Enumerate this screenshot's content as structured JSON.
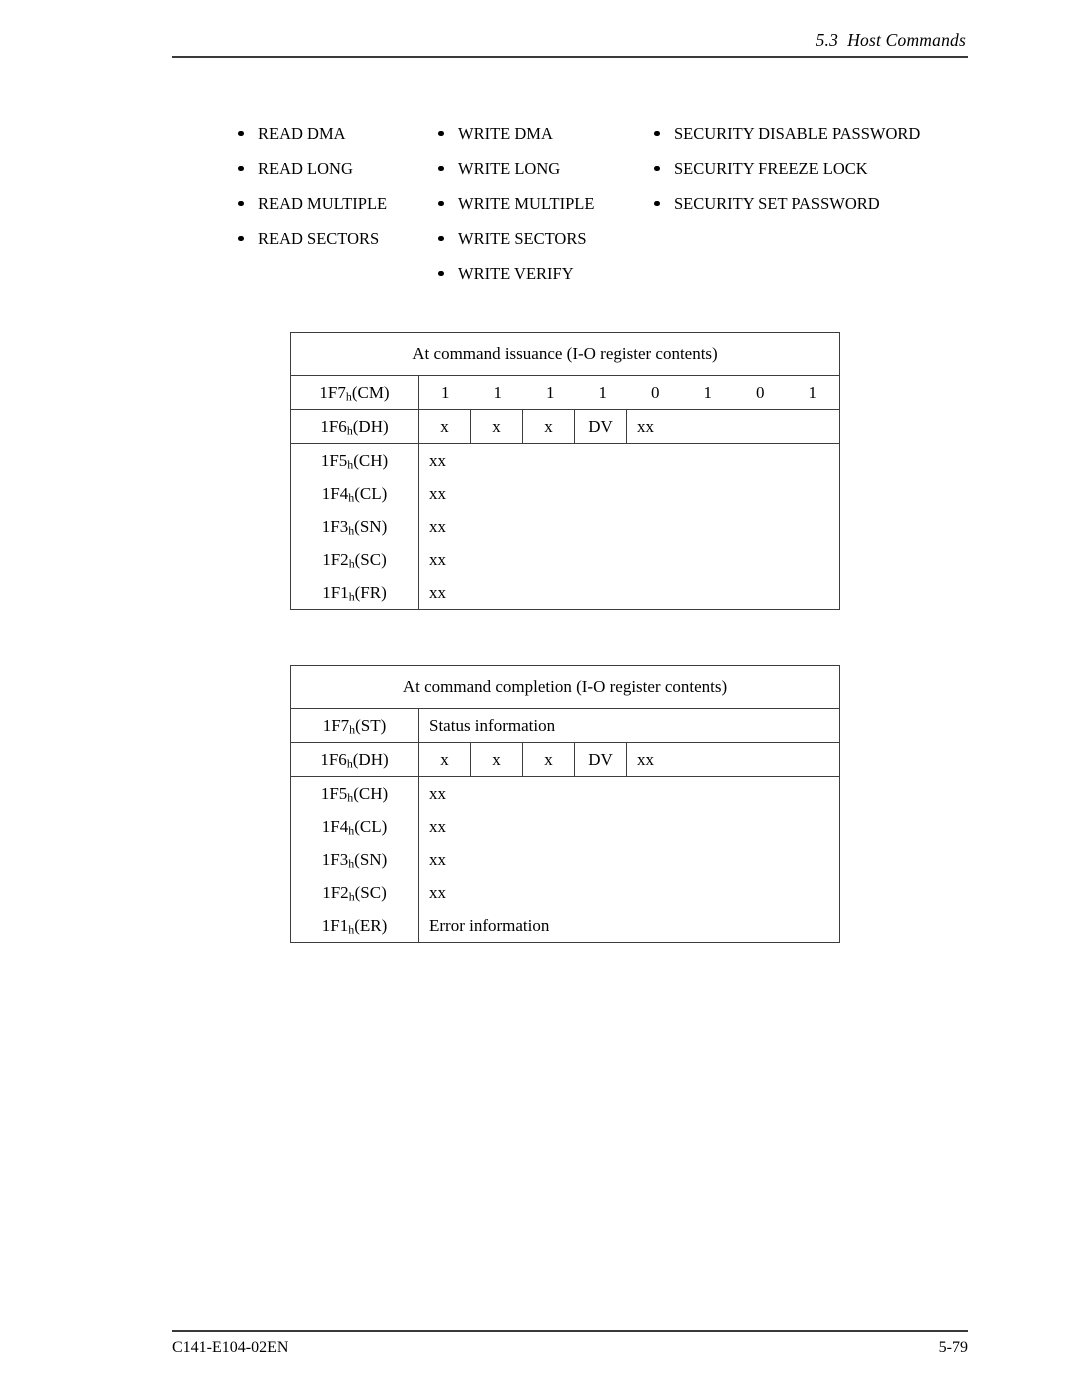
{
  "header": {
    "section": "5.3  Host Commands"
  },
  "command_columns": [
    {
      "name": "read-commands",
      "items": [
        "READ DMA",
        "READ LONG",
        "READ MULTIPLE",
        "READ SECTORS"
      ]
    },
    {
      "name": "write-commands",
      "items": [
        "WRITE DMA",
        "WRITE LONG",
        "WRITE MULTIPLE",
        "WRITE SECTORS",
        "WRITE VERIFY"
      ]
    },
    {
      "name": "security-commands",
      "items": [
        "SECURITY DISABLE PASSWORD",
        "SECURITY FREEZE LOCK",
        "SECURITY SET PASSWORD"
      ]
    }
  ],
  "tables": {
    "issuance": {
      "caption": "At command issuance (I-O register contents)",
      "command_row": {
        "address": "1F7",
        "subscript": "h",
        "register": "(CM)",
        "bits": [
          "1",
          "1",
          "1",
          "1",
          "0",
          "1",
          "0",
          "1"
        ]
      },
      "device_head_row": {
        "address": "1F6",
        "subscript": "h",
        "register": "(DH)",
        "cells": [
          "x",
          "x",
          "x",
          "DV"
        ],
        "rest": "xx"
      },
      "rows": [
        {
          "address": "1F5",
          "subscript": "h",
          "register": "(CH)",
          "value": "xx"
        },
        {
          "address": "1F4",
          "subscript": "h",
          "register": "(CL)",
          "value": "xx"
        },
        {
          "address": "1F3",
          "subscript": "h",
          "register": "(SN)",
          "value": "xx"
        },
        {
          "address": "1F2",
          "subscript": "h",
          "register": "(SC)",
          "value": "xx"
        },
        {
          "address": "1F1",
          "subscript": "h",
          "register": "(FR)",
          "value": "xx"
        }
      ]
    },
    "completion": {
      "caption": "At command completion (I-O register contents)",
      "status_row": {
        "address": "1F7",
        "subscript": "h",
        "register": "(ST)",
        "value": "Status information"
      },
      "device_head_row": {
        "address": "1F6",
        "subscript": "h",
        "register": "(DH)",
        "cells": [
          "x",
          "x",
          "x",
          "DV"
        ],
        "rest": "xx"
      },
      "rows": [
        {
          "address": "1F5",
          "subscript": "h",
          "register": "(CH)",
          "value": "xx"
        },
        {
          "address": "1F4",
          "subscript": "h",
          "register": "(CL)",
          "value": "xx"
        },
        {
          "address": "1F3",
          "subscript": "h",
          "register": "(SN)",
          "value": "xx"
        },
        {
          "address": "1F2",
          "subscript": "h",
          "register": "(SC)",
          "value": "xx"
        },
        {
          "address": "1F1",
          "subscript": "h",
          "register": "(ER)",
          "value": "Error information"
        }
      ]
    }
  },
  "footer": {
    "document_number": "C141-E104-02EN",
    "page_number": "5-79"
  }
}
